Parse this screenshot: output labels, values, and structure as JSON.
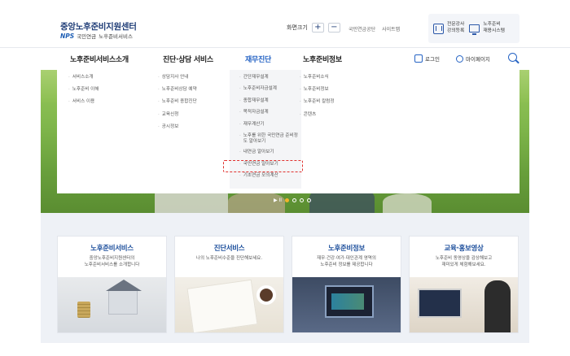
{
  "header": {
    "title": "중앙노후준비지원센터",
    "nps_logo": "NPS",
    "nps_org": "국민연금",
    "subtitle": "노후준비서비스",
    "zoom_label": "화면크기",
    "zoom_in": "+",
    "zoom_out": "−",
    "links": [
      "국민연금공단",
      "사이트맵"
    ],
    "quick": [
      {
        "label": "전문강사\n강의등록",
        "icon": "building-icon"
      },
      {
        "label": "노후준비\n재용시스템",
        "icon": "monitor-icon"
      }
    ]
  },
  "gnb": {
    "menus": [
      "노후준비서비스소개",
      "진단·상담 서비스",
      "재무진단",
      "노후준비정보"
    ],
    "active_index": 2,
    "login": "로그인",
    "mypage": "마이페이지",
    "active_color": "#2563c4"
  },
  "dropdown": {
    "col1": [
      "서비스소개",
      "노후준비 이해",
      "서비스 이용"
    ],
    "col2": [
      "상담지사 안내",
      "노후준비상담 예약",
      "노후준비 종합진단",
      "교육신청",
      "공시정보"
    ],
    "col3": [
      "간단재무설계",
      "노후준비자금설계",
      "종합재무설계",
      "목적자금설계",
      "재무계산기",
      "노후를 위한 국민연금 준비정도 알아보기",
      "내연금 알아보기",
      "국민연금 알아보기",
      "기초연금 모의계산"
    ],
    "col4": [
      "노후준비소식",
      "노후준비정보",
      "노후준비 칼럼정",
      "콘텐츠"
    ]
  },
  "slider": {
    "controls": "▶ II",
    "dot_count": 4,
    "active_dot": 0
  },
  "cards": [
    {
      "title": "노후준비서비스",
      "desc": "중앙노후준비지원센터의\n노후준비서비스를 소개합니다"
    },
    {
      "title": "진단서비스",
      "desc": "나의 노후준비수준을 진단해보세요."
    },
    {
      "title": "노후준비정보",
      "desc": "재무·건강·여가·대인관계 영역의\n노후준비 정보를 제공합니다"
    },
    {
      "title": "교육·홍보영상",
      "desc": "노후준비 동영상을 감상해보고\n재미있게 체험해보세요."
    }
  ],
  "colors": {
    "brand": "#1f3d77",
    "accent": "#2563c4",
    "highlight_dashed": "#e0322f"
  }
}
